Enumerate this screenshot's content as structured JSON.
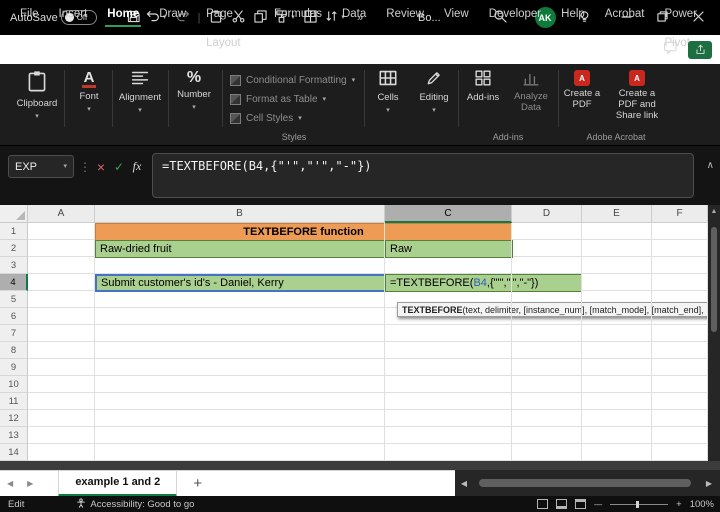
{
  "glyphs": {
    "chevron": "▾",
    "overflow": "»",
    "dots": "⋮",
    "collapse": "∧",
    "cancel": "×",
    "enter": "✓",
    "fx": "fx",
    "percent": "%",
    "font_a": "A",
    "add_sheet": "+",
    "nav_left": "◀",
    "nav_right": "▶",
    "scroll_up": "▲",
    "scroll_down": "▼",
    "zoom_out": "—",
    "zoom_in": "+",
    "pdf_badge": "A"
  },
  "titlebar": {
    "autosave_label": "AutoSave",
    "autosave_state": "Off",
    "workbook_title": "Bo...",
    "avatar_initials": "AK"
  },
  "menubar": {
    "tabs": [
      "File",
      "Insert",
      "Home",
      "Draw",
      "Page Layout",
      "Formulas",
      "Data",
      "Review",
      "View",
      "Developer",
      "Help",
      "Acrobat",
      "Power Pivot"
    ],
    "active_tab": "Home"
  },
  "ribbon": {
    "clipboard_label": "Clipboard",
    "font_label": "Font",
    "alignment_label": "Alignment",
    "number_label": "Number",
    "styles_items": [
      "Conditional Formatting",
      "Format as Table",
      "Cell Styles"
    ],
    "styles_group_label": "Styles",
    "cells_label": "Cells",
    "editing_label": "Editing",
    "addins_label": "Add-ins",
    "analyze_label": "Analyze Data",
    "addins_group_label": "Add-ins",
    "pdf_label": "Create a PDF",
    "pdf_share_label": "Create a PDF and Share link",
    "acrobat_group_label": "Adobe Acrobat"
  },
  "formula_bar": {
    "name_box": "EXP",
    "formula": "=TEXTBEFORE(B4,{\"'\",\"'\",\"-\"})"
  },
  "grid": {
    "columns": [
      "A",
      "B",
      "C",
      "D",
      "E",
      "F"
    ],
    "rows": [
      "1",
      "2",
      "3",
      "4",
      "5",
      "6",
      "7",
      "8",
      "9",
      "10",
      "11",
      "12",
      "13",
      "14"
    ],
    "selected_column": "C",
    "selected_row": "4",
    "cells": {
      "banner": "TEXTBEFORE function",
      "b2": "Raw-dried fruit",
      "c2": "Raw",
      "b4": "Submit customer's id's - Daniel, Kerry",
      "c4_prefix": "=TEXTBEFORE(",
      "c4_ref": "B4",
      "c4_suffix": ",{\"'\",\"'\",\"-\"})"
    },
    "tooltip_bold": "TEXTBEFORE",
    "tooltip_rest": "(text, delimiter, [instance_num], [match_mode], [match_end],"
  },
  "sheet_bar": {
    "tab_label": "example 1 and 2"
  },
  "status_bar": {
    "mode": "Edit",
    "accessibility": "Accessibility: Good to go",
    "zoom": "100%"
  }
}
